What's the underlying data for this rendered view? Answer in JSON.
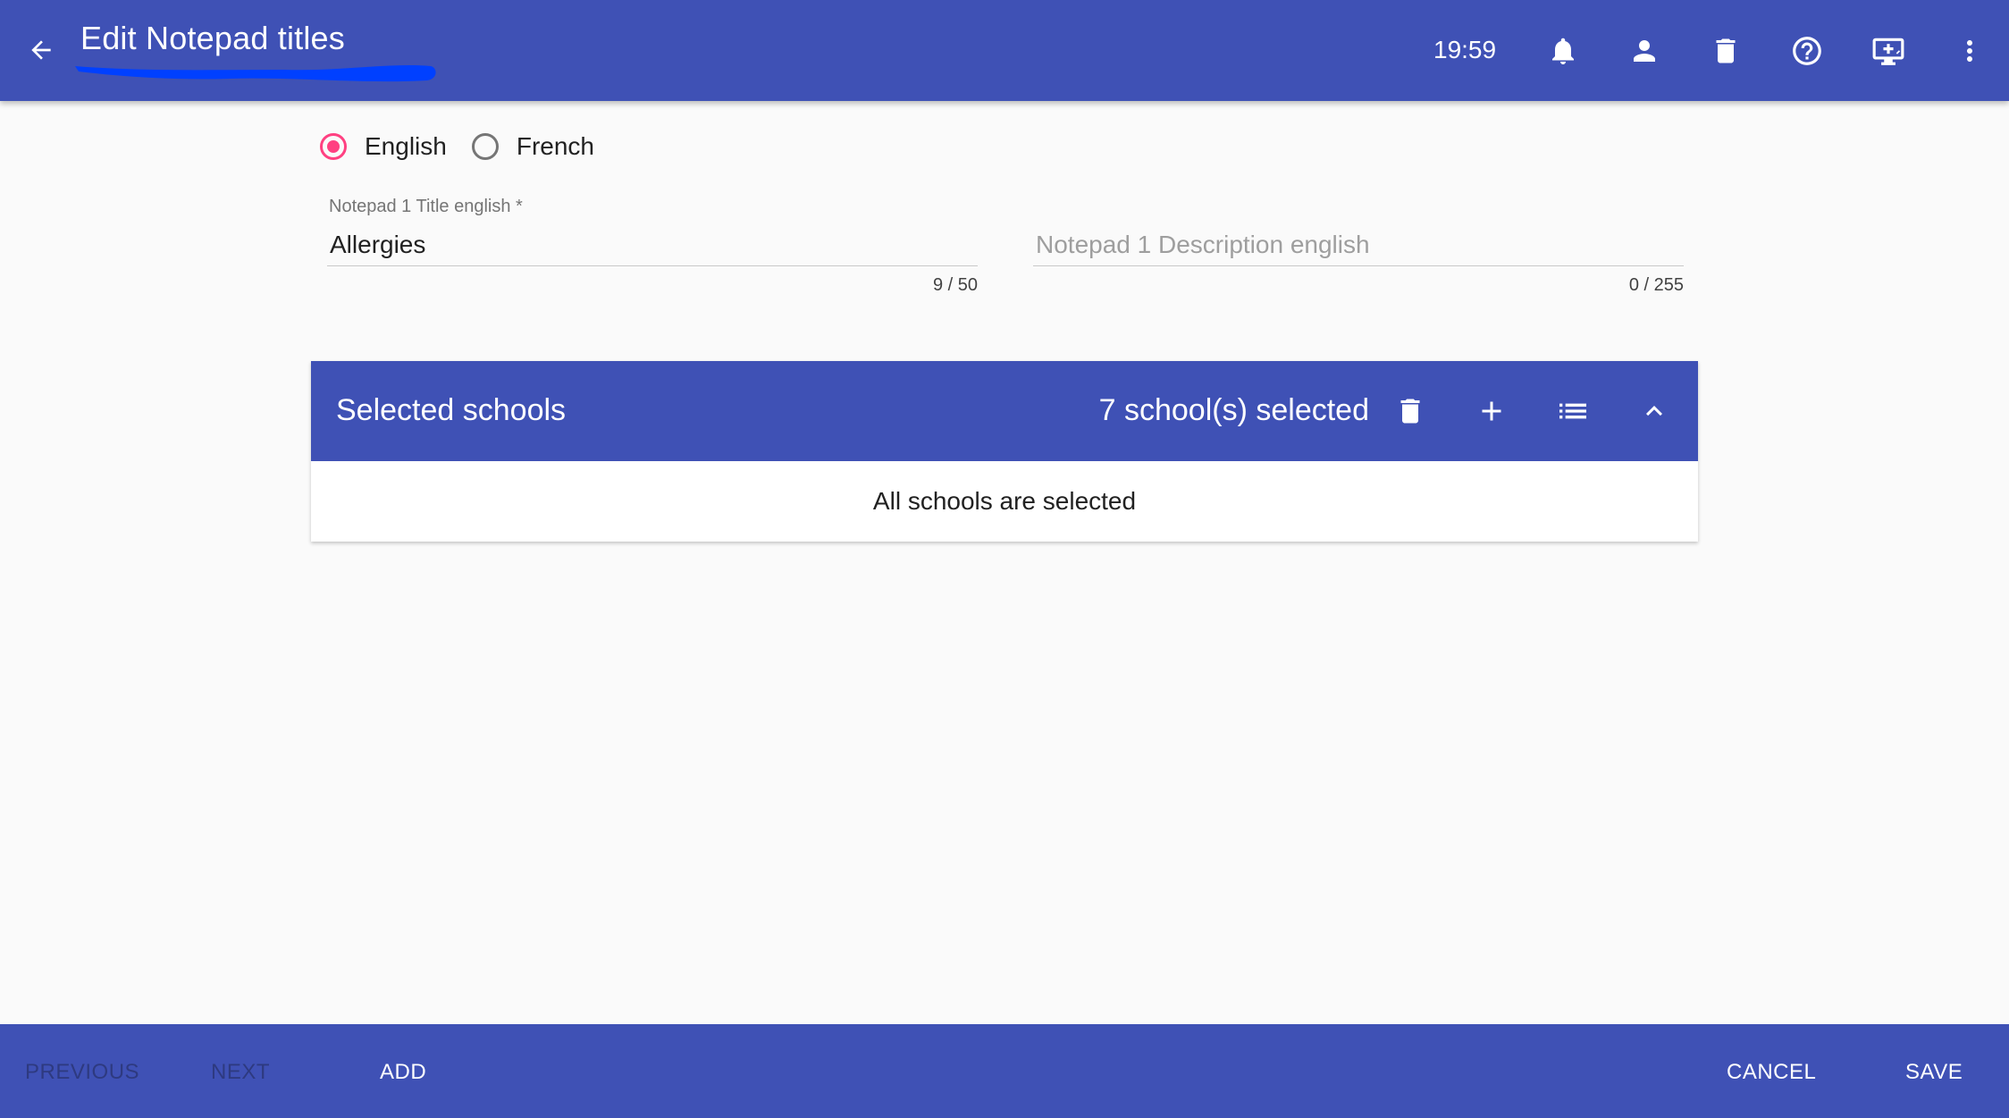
{
  "header": {
    "title": "Edit Notepad titles",
    "clock": "19:59",
    "icons": [
      "back-arrow-icon",
      "bell-icon",
      "person-icon",
      "trash-icon",
      "help-circle-icon",
      "screen-share-icon",
      "more-vert-icon"
    ]
  },
  "language": {
    "options": [
      {
        "label": "English",
        "selected": true
      },
      {
        "label": "French",
        "selected": false
      }
    ]
  },
  "title_field": {
    "label": "Notepad 1 Title english *",
    "value": "Allergies",
    "counter": "9 / 50"
  },
  "description_field": {
    "placeholder": "Notepad 1 Description english",
    "value": "",
    "counter": "0 / 255"
  },
  "schools": {
    "title": "Selected schools",
    "count_text": "7 school(s) selected",
    "body_text": "All schools are selected"
  },
  "footer": {
    "previous": "PREVIOUS",
    "next": "NEXT",
    "add": "ADD",
    "cancel": "CANCEL",
    "save": "SAVE"
  },
  "colors": {
    "primary": "#3f51b5",
    "accent": "#ff4081",
    "scribble": "#0040ff"
  }
}
